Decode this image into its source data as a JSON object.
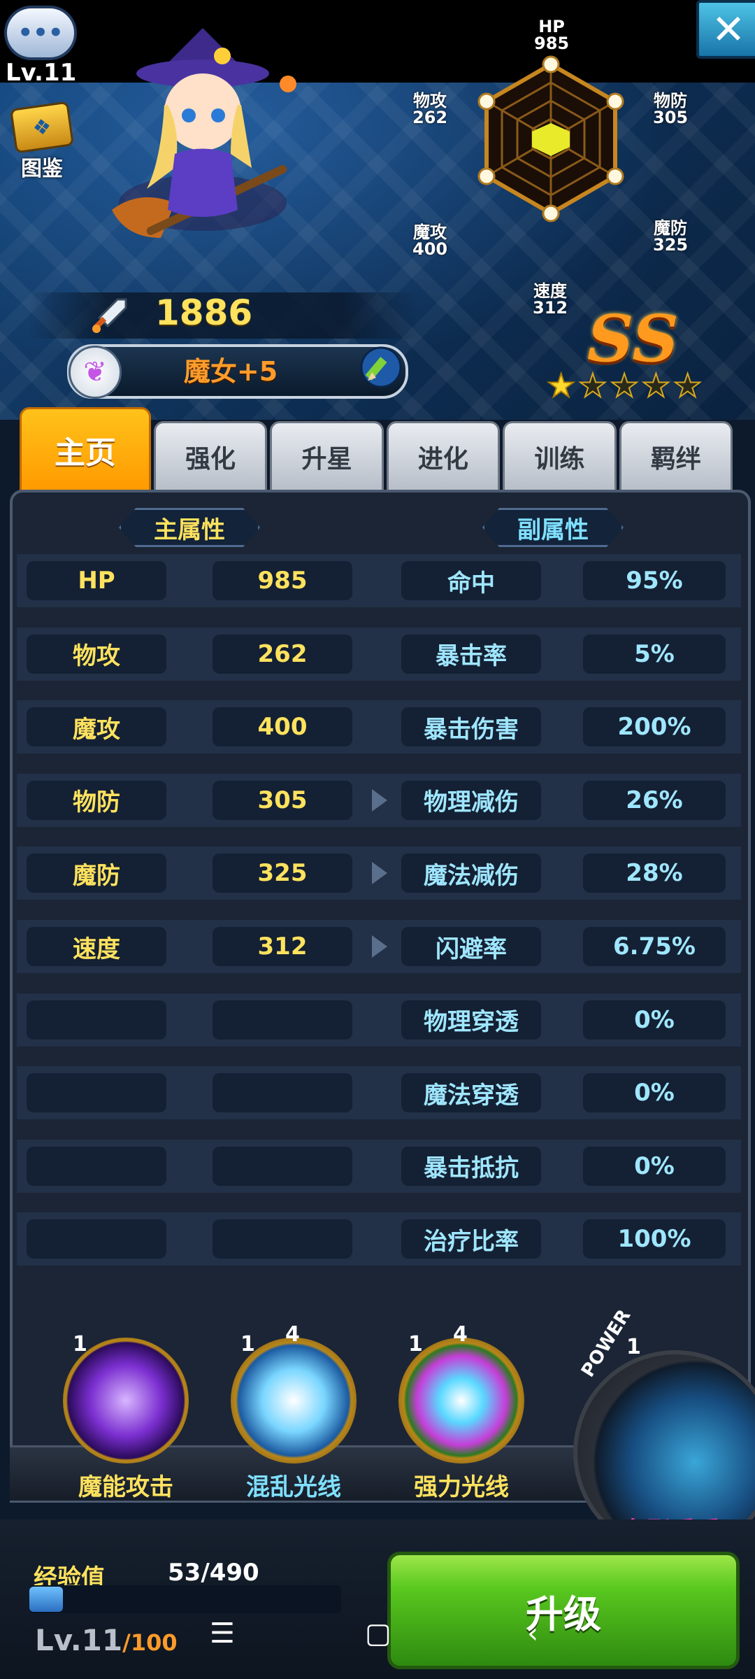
{
  "header": {
    "chat_icon": "chat-bubbles-icon",
    "level": "Lv.11",
    "codex_label": "图鉴",
    "close_icon": "close-icon"
  },
  "radar": {
    "hp_label": "HP",
    "hp_value": "985",
    "pattack_label": "物攻",
    "pattack_value": "262",
    "pdef_label": "物防",
    "pdef_value": "305",
    "mattack_label": "魔攻",
    "mattack_value": "400",
    "mdef_label": "魔防",
    "mdef_value": "325",
    "speed_label": "速度",
    "speed_value": "312"
  },
  "hero": {
    "power": "1886",
    "name": "魔女+5",
    "rank": "SS",
    "stars_filled": 1,
    "stars_total": 5
  },
  "tabs": [
    {
      "label": "主页",
      "active": true
    },
    {
      "label": "强化",
      "active": false
    },
    {
      "label": "升星",
      "active": false
    },
    {
      "label": "进化",
      "active": false
    },
    {
      "label": "训练",
      "active": false
    },
    {
      "label": "羁绊",
      "active": false
    }
  ],
  "stats": {
    "main_title": "主属性",
    "sub_title": "副属性",
    "rows": [
      {
        "main_name": "HP",
        "main_value": "985",
        "sub_name": "命中",
        "sub_value": "95%",
        "arrow": false
      },
      {
        "main_name": "物攻",
        "main_value": "262",
        "sub_name": "暴击率",
        "sub_value": "5%",
        "arrow": false
      },
      {
        "main_name": "魔攻",
        "main_value": "400",
        "sub_name": "暴击伤害",
        "sub_value": "200%",
        "arrow": false
      },
      {
        "main_name": "物防",
        "main_value": "305",
        "sub_name": "物理减伤",
        "sub_value": "26%",
        "arrow": true
      },
      {
        "main_name": "魔防",
        "main_value": "325",
        "sub_name": "魔法减伤",
        "sub_value": "28%",
        "arrow": true
      },
      {
        "main_name": "速度",
        "main_value": "312",
        "sub_name": "闪避率",
        "sub_value": "6.75%",
        "arrow": true
      },
      {
        "main_name": "",
        "main_value": "",
        "sub_name": "物理穿透",
        "sub_value": "0%",
        "arrow": false
      },
      {
        "main_name": "",
        "main_value": "",
        "sub_name": "魔法穿透",
        "sub_value": "0%",
        "arrow": false
      },
      {
        "main_name": "",
        "main_value": "",
        "sub_name": "暴击抵抗",
        "sub_value": "0%",
        "arrow": false
      },
      {
        "main_name": "",
        "main_value": "",
        "sub_name": "治疗比率",
        "sub_value": "100%",
        "arrow": false
      }
    ]
  },
  "skills": [
    {
      "name": "魔能攻击",
      "level": "1",
      "stars": "",
      "color": "#ffe25e"
    },
    {
      "name": "混乱光线",
      "level": "1",
      "stars": "4",
      "color": "#7fe0ff"
    },
    {
      "name": "强力光线",
      "level": "1",
      "stars": "4",
      "color": "#ffe25e"
    }
  ],
  "power_skill": {
    "label": "POWER",
    "level": "1",
    "name": "鬼影重重"
  },
  "footer": {
    "exp_label": "经验值",
    "exp_value": "53/490",
    "exp_fraction": 0.108,
    "level": "Lv.11",
    "level_max": "/100",
    "upgrade_label": "升级"
  },
  "colors": {
    "accent_gold": "#ffe25e",
    "accent_cyan": "#7fe0ff",
    "tab_active": "#ff9a00",
    "upgrade_green": "#59c81f"
  }
}
